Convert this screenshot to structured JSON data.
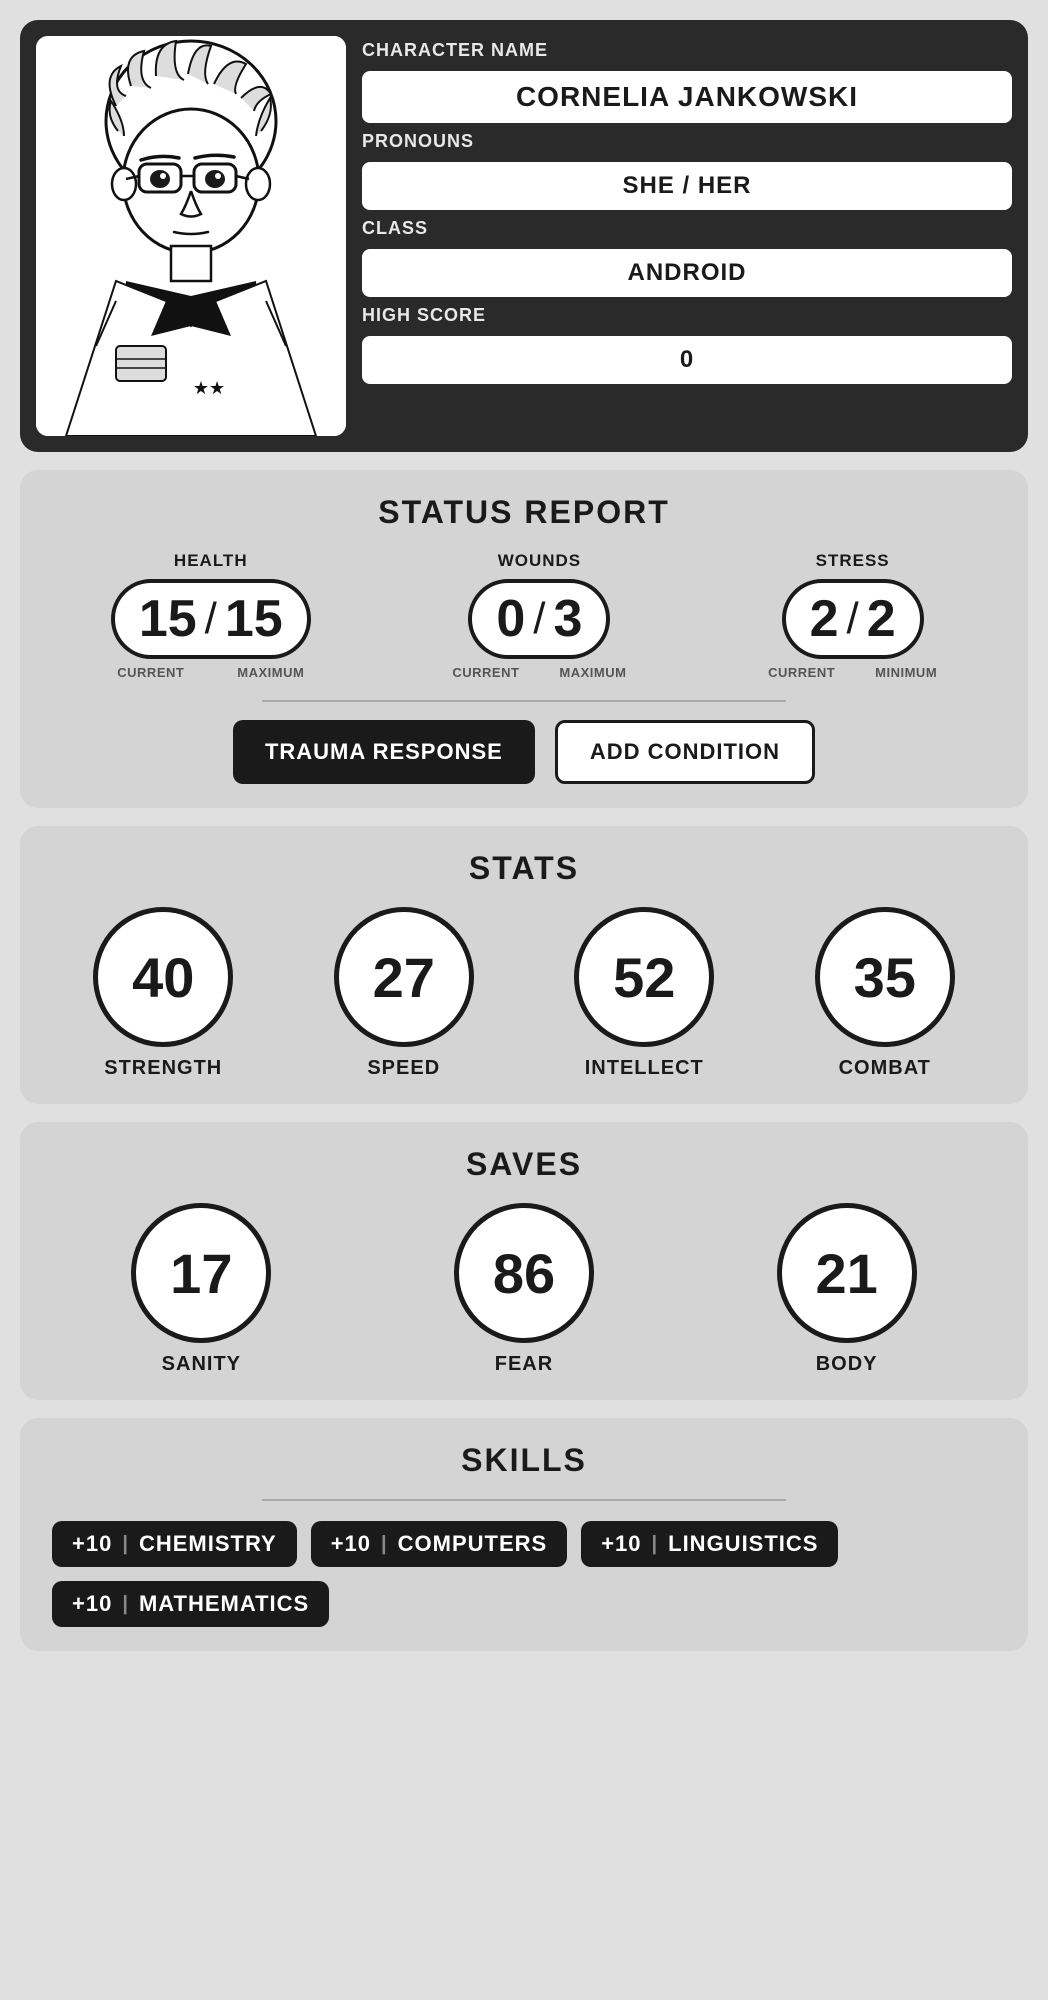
{
  "character": {
    "name_label": "CHARACTER NAME",
    "name_value": "CORNELIA JANKOWSKI",
    "pronouns_label": "PRONOUNS",
    "pronouns_value": "SHE / HER",
    "class_label": "CLASS",
    "class_value": "ANDROID",
    "high_score_label": "HIGH SCORE",
    "high_score_value": "0"
  },
  "status": {
    "section_title": "STATUS REPORT",
    "health_label": "HEALTH",
    "health_current": "15",
    "health_max": "15",
    "health_current_label": "CURRENT",
    "health_max_label": "MAXIMUM",
    "wounds_label": "WOUNDS",
    "wounds_current": "0",
    "wounds_max": "3",
    "wounds_current_label": "CURRENT",
    "wounds_max_label": "MAXIMUM",
    "stress_label": "STRESS",
    "stress_current": "2",
    "stress_min": "2",
    "stress_current_label": "CURRENT",
    "stress_min_label": "MINIMUM",
    "trauma_btn": "TRAUMA RESPONSE",
    "add_condition_btn": "ADD CONDITION"
  },
  "stats": {
    "section_title": "STATS",
    "items": [
      {
        "value": "40",
        "label": "STRENGTH"
      },
      {
        "value": "27",
        "label": "SPEED"
      },
      {
        "value": "52",
        "label": "INTELLECT"
      },
      {
        "value": "35",
        "label": "COMBAT"
      }
    ]
  },
  "saves": {
    "section_title": "SAVES",
    "items": [
      {
        "value": "17",
        "label": "SANITY"
      },
      {
        "value": "86",
        "label": "FEAR"
      },
      {
        "value": "21",
        "label": "BODY"
      }
    ]
  },
  "skills": {
    "section_title": "SKILLS",
    "items": [
      {
        "bonus": "+10",
        "label": "CHEMISTRY"
      },
      {
        "bonus": "+10",
        "label": "COMPUTERS"
      },
      {
        "bonus": "+10",
        "label": "LINGUISTICS"
      },
      {
        "bonus": "+10",
        "label": "MATHEMATICS"
      }
    ]
  }
}
